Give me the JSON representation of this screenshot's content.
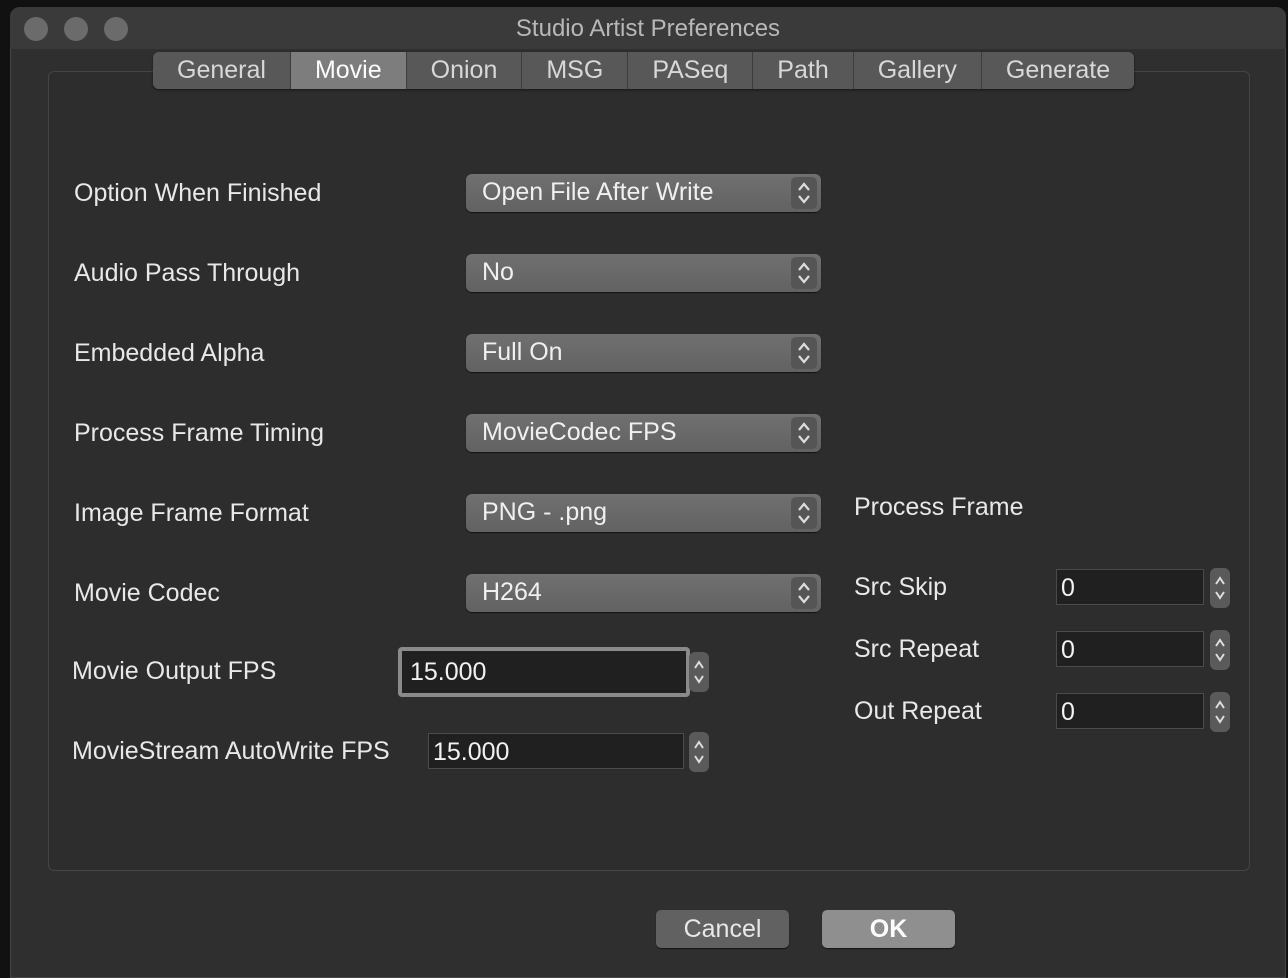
{
  "window": {
    "title": "Studio Artist Preferences"
  },
  "tabs": [
    {
      "label": "General"
    },
    {
      "label": "Movie"
    },
    {
      "label": "Onion"
    },
    {
      "label": "MSG"
    },
    {
      "label": "PASeq"
    },
    {
      "label": "Path"
    },
    {
      "label": "Gallery"
    },
    {
      "label": "Generate"
    }
  ],
  "active_tab": "Movie",
  "settings": {
    "option_when_finished": {
      "label": "Option When Finished",
      "value": "Open File After Write"
    },
    "audio_pass_through": {
      "label": "Audio Pass Through",
      "value": "No"
    },
    "embedded_alpha": {
      "label": "Embedded Alpha",
      "value": "Full On"
    },
    "process_frame_timing": {
      "label": "Process Frame Timing",
      "value": "MovieCodec FPS"
    },
    "image_frame_format": {
      "label": "Image Frame Format",
      "value": "PNG - .png"
    },
    "movie_codec": {
      "label": "Movie Codec",
      "value": "H264"
    },
    "movie_output_fps": {
      "label": "Movie Output FPS",
      "value": "15.000"
    },
    "moviestream_autowrite_fps": {
      "label": "MovieStream AutoWrite FPS",
      "value": "15.000"
    }
  },
  "process_frame": {
    "heading": "Process Frame",
    "src_skip": {
      "label": "Src Skip",
      "value": "0"
    },
    "src_repeat": {
      "label": "Src Repeat",
      "value": "0"
    },
    "out_repeat": {
      "label": "Out Repeat",
      "value": "0"
    }
  },
  "buttons": {
    "cancel": "Cancel",
    "ok": "OK"
  },
  "icons": {
    "popup_arrows": "up-down-chevron-icon",
    "stepper": "stepper-arrows-icon"
  }
}
